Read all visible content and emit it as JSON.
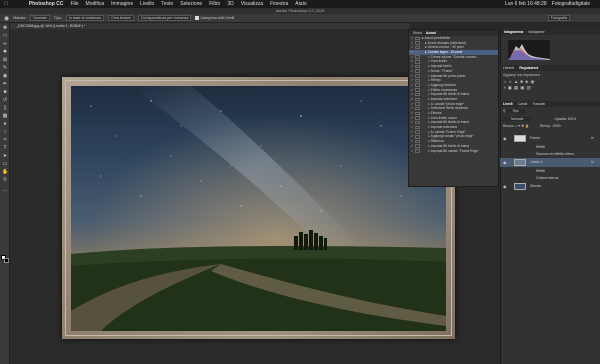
{
  "menubar": {
    "app": "Photoshop CC",
    "items": [
      "File",
      "Modifica",
      "Immagine",
      "Livello",
      "Testo",
      "Selezione",
      "Filtro",
      "3D",
      "Visualizza",
      "Finestra",
      "Aiuto"
    ],
    "clock": "Lun 6 feb  16:48:28",
    "user": "Fotografiadigitale"
  },
  "window": {
    "title": "Adobe Photoshop CC 2015"
  },
  "options": {
    "mode_label": "Metodo:",
    "mode_value": "Normale",
    "flow_label": "Tipo:",
    "content_aware": "In base al contenuto",
    "create_texture": "Crea texture",
    "proximity": "Corrispondenza per vicinanza",
    "sample_all": "Campiona tutti i livelli",
    "workspace": "Fotografia"
  },
  "document": {
    "tab": "_DSC3398.jpg @ 16% (Livello 1, RGB/8*) *"
  },
  "tools": [
    "move",
    "marquee",
    "lasso",
    "quick-select",
    "crop",
    "eyedropper",
    "healing",
    "brush",
    "stamp",
    "history-brush",
    "eraser",
    "gradient",
    "blur",
    "dodge",
    "pen",
    "type",
    "path-select",
    "shape",
    "hand",
    "zoom"
  ],
  "actions_panel": {
    "tabs": [
      "Storia",
      "Azioni"
    ],
    "active_tab": "Azioni",
    "rows": [
      {
        "label": "Azioni predefinite",
        "checked": true,
        "indent": 0,
        "selected": false
      },
      {
        "label": "Bordo sfumato (selezione)",
        "checked": true,
        "indent": 1,
        "selected": false
      },
      {
        "label": "Ombra cornice - 50 pixel",
        "checked": true,
        "indent": 1,
        "selected": false
      },
      {
        "label": "Cornice legno - 50 pixel",
        "checked": true,
        "indent": 1,
        "selected": true
      },
      {
        "label": "Creare azione \"Grande cornice...",
        "checked": true,
        "indent": 2,
        "selected": false
      },
      {
        "label": "Crea livello",
        "checked": true,
        "indent": 2,
        "selected": false
      },
      {
        "label": "Imposta livello",
        "checked": true,
        "indent": 2,
        "selected": false
      },
      {
        "label": "Nome: \"Frame\"",
        "checked": true,
        "indent": 2,
        "selected": false
      },
      {
        "label": "Imposta Bit primo piano",
        "checked": true,
        "indent": 2,
        "selected": false
      },
      {
        "label": "Riempi",
        "checked": true,
        "indent": 2,
        "selected": false
      },
      {
        "label": "Aggiungi disturbo",
        "checked": true,
        "indent": 2,
        "selected": false
      },
      {
        "label": "Effetto movimento",
        "checked": true,
        "indent": 2,
        "selected": false
      },
      {
        "label": "Imposta Bit livello di trama",
        "checked": true,
        "indent": 2,
        "selected": false
      },
      {
        "label": "Imposta selezione",
        "checked": true,
        "indent": 2,
        "selected": false
      },
      {
        "label": "A: canale \"photo edge\"",
        "checked": true,
        "indent": 2,
        "selected": false
      },
      {
        "label": "Selezione livello depends",
        "checked": true,
        "indent": 2,
        "selected": false
      },
      {
        "label": "Elimina",
        "checked": true,
        "indent": 2,
        "selected": false
      },
      {
        "label": "Crea livello nuovo",
        "checked": true,
        "indent": 2,
        "selected": false
      },
      {
        "label": "Imposta Bit livello di trama",
        "checked": true,
        "indent": 2,
        "selected": false
      },
      {
        "label": "Imposta selezione",
        "checked": true,
        "indent": 2,
        "selected": false
      },
      {
        "label": "A: canale \"Frame Edge\"",
        "checked": true,
        "indent": 2,
        "selected": false
      },
      {
        "label": "Aggiungi canale \"photo edge\"",
        "checked": true,
        "indent": 2,
        "selected": false
      },
      {
        "label": "Rifinitura",
        "checked": true,
        "indent": 2,
        "selected": false
      },
      {
        "label": "Imposta Bit livello di trama",
        "checked": true,
        "indent": 2,
        "selected": false
      },
      {
        "label": "Imposta Bit canale \"Frame Edge\"",
        "checked": true,
        "indent": 2,
        "selected": false
      }
    ]
  },
  "right_panel": {
    "top_tabs": [
      "Istogramma",
      "Navigatore"
    ],
    "adj_tabs": [
      "Librerie",
      "Regolazioni"
    ],
    "adj_title": "Aggiungi una regolazione",
    "layers_tabs": [
      "Livelli",
      "Canali",
      "Tracciati"
    ],
    "kind_label": "Tipo",
    "blend": "Normale",
    "opacity_label": "Opacità:",
    "opacity_value": "100%",
    "lock_label": "Blocca:",
    "fill_label": "Riemp.:",
    "fill_value": "100%",
    "layers": [
      {
        "name": "Frame",
        "fx": true,
        "selected": false
      },
      {
        "name": "Effetti",
        "fx": false,
        "selected": false
      },
      {
        "name": "Smusso ed effetto rilievo",
        "fx": false,
        "selected": false
      },
      {
        "name": "Livello 1",
        "fx": true,
        "selected": true
      },
      {
        "name": "Effetti",
        "fx": false,
        "selected": false
      },
      {
        "name": "Ombra interna",
        "fx": false,
        "selected": false
      },
      {
        "name": "Sfondo",
        "fx": false,
        "selected": false
      }
    ]
  },
  "colors": {
    "accent": "#4a5f80",
    "panel": "#383838",
    "bg": "#282828"
  }
}
